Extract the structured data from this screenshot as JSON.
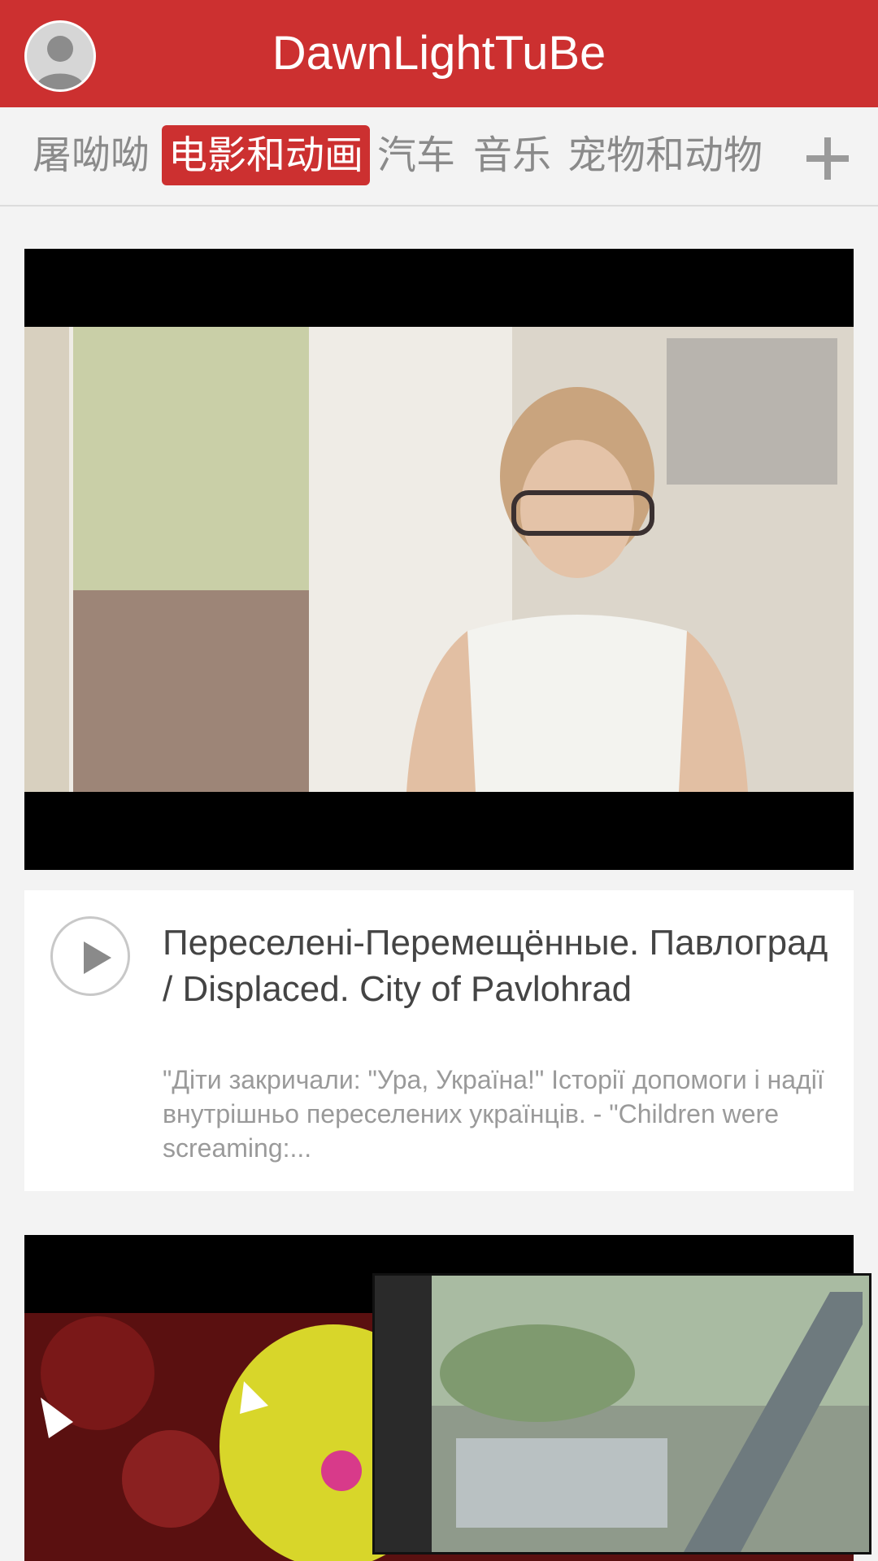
{
  "header": {
    "app_title": "DawnLightTuBe",
    "avatar_icon": "user-avatar-icon",
    "accent_color": "#cc3030"
  },
  "tabs": [
    {
      "label": "屠呦呦",
      "active": false
    },
    {
      "label": "电影和动画",
      "active": true
    },
    {
      "label": "汽车",
      "active": false
    },
    {
      "label": "音乐",
      "active": false
    },
    {
      "label": "宠物和动物",
      "active": false
    }
  ],
  "tabs_add_icon": "plus-icon",
  "feed": [
    {
      "title": "Переселені-Перемещённые. Павлоград / Displaced. City of Pavlohrad",
      "description": "\"Діти закричали: \"Ура, Україна!\" Історії допомоги і надії внутрішньо переселених українців. - \"Children were screaming:...",
      "play_icon": "play-icon"
    }
  ]
}
